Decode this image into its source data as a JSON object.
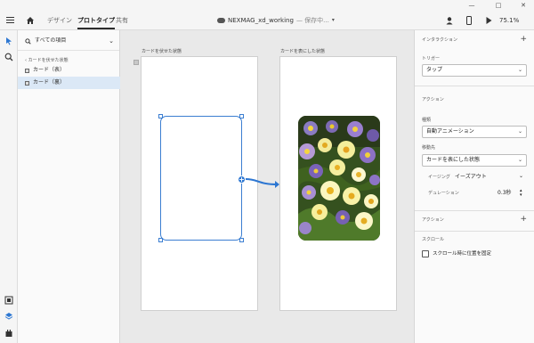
{
  "menubar": {
    "tabs": [
      {
        "label": "デザイン"
      },
      {
        "label": "プロトタイプ"
      },
      {
        "label": "共有"
      }
    ],
    "doc_name": "NEXMAG_xd_working",
    "doc_status": "— 保存中...",
    "zoom": "75.1%"
  },
  "window_controls": [
    "—",
    "□",
    "✕"
  ],
  "layers": {
    "search_label": "すべての項目",
    "breadcrumb": "カードを伏せた状態",
    "items": [
      {
        "label": "カード（表）"
      },
      {
        "label": "カード（裏）"
      }
    ]
  },
  "canvas": {
    "artboard_left": "カードを伏せた状態",
    "artboard_right": "カードを表にした状態"
  },
  "props": {
    "interaction_header": "インタラクション",
    "trigger_label": "トリガー",
    "trigger_value": "タップ",
    "action_header": "アクション",
    "type_label": "種類",
    "type_value": "自動アニメーション",
    "destination_label": "移動先",
    "destination_value": "カードを表にした状態",
    "easing_label": "イージング",
    "easing_value": "イーズアウト",
    "duration_label": "デュレーション",
    "duration_value": "0.3秒",
    "action_add_label": "アクション",
    "scroll_header": "スクロール",
    "scroll_checkbox_label": "スクロール時に位置を固定"
  },
  "colors": {
    "accent": "#2d77d2",
    "selection": "#3b7ed1",
    "layer_selected_bg": "#dbe8f6"
  }
}
